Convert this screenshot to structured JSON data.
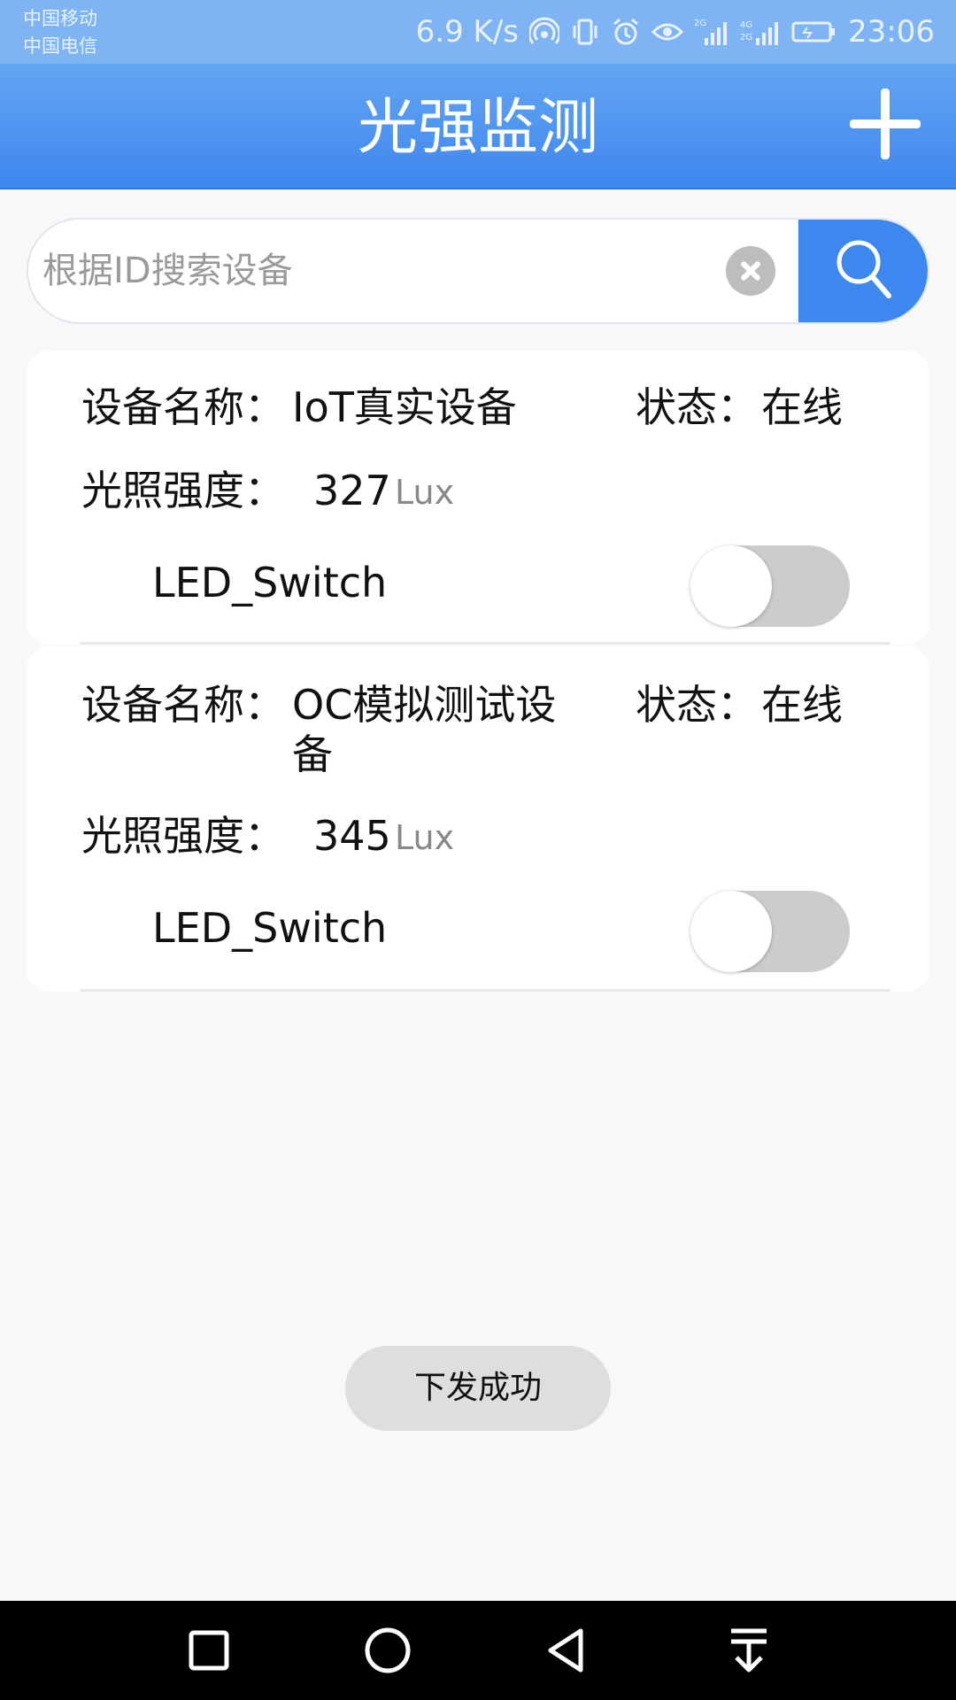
{
  "status_bar": {
    "carrier_1": "中国移动",
    "carrier_2": "中国电信",
    "net_speed": "6.9 K/s",
    "time": "23:06",
    "icons": [
      "hotspot-icon",
      "vibrate-icon",
      "alarm-icon",
      "eye-comfort-icon",
      "signal-2g-icon",
      "signal-4g-icon",
      "battery-icon"
    ]
  },
  "app_bar": {
    "title": "光强监测",
    "add_icon": "plus-icon"
  },
  "search": {
    "placeholder": "根据ID搜索设备",
    "value": "",
    "clear_icon": "clear-icon",
    "search_icon": "search-icon"
  },
  "devices": [
    {
      "name_label": "设备名称：",
      "name": "IoT真实设备",
      "status_label": "状态：",
      "status": "在线",
      "lux_label": "光照强度：",
      "lux_value": "327",
      "lux_unit": "Lux",
      "switch_label": "LED_Switch",
      "switch_on": false
    },
    {
      "name_label": "设备名称：",
      "name": "OC模拟测试设备",
      "status_label": "状态：",
      "status": "在线",
      "lux_label": "光照强度：",
      "lux_value": "345",
      "lux_unit": "Lux",
      "switch_label": "LED_Switch",
      "switch_on": false
    }
  ],
  "toast": {
    "message": "下发成功"
  },
  "nav_bar": {
    "icons": [
      "recents-icon",
      "home-icon",
      "back-icon",
      "notification-pull-icon"
    ]
  },
  "colors": {
    "status_bar": "#7fb4f4",
    "app_bar_top": "#64a6f3",
    "app_bar_bottom": "#3d86ee",
    "search_button": "#3d88ee",
    "toggle_off": "#cccccc",
    "background": "#f8f8f8"
  }
}
